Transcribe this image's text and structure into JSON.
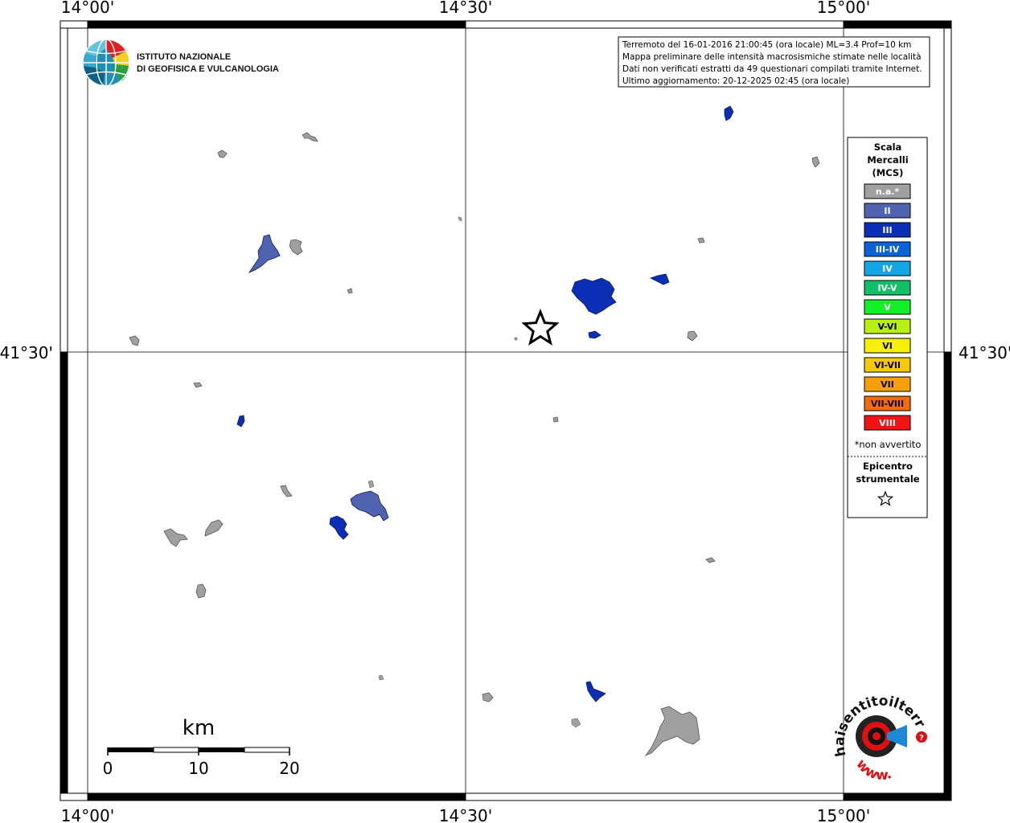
{
  "axes": {
    "top_labels": [
      "14°00'",
      "14°30'",
      "15°00'"
    ],
    "bottom_labels": [
      "14°00'",
      "14°30'",
      "15°00'"
    ],
    "left_label": "41°30'",
    "right_label": "41°30'"
  },
  "info_box": {
    "lines": [
      "Terremoto del 16-01-2016 21:00:45 (ora locale) ML=3.4 Prof=10 km",
      "Mappa preliminare delle intensità macrosismiche stimate nelle località",
      "Dati non verificati estratti da 49 questionari compilati tramite Internet.",
      "Ultimo aggiornamento: 20-12-2025 02:45 (ora locale)"
    ]
  },
  "logo": {
    "line1": "ISTITUTO NAZIONALE",
    "line2": "DI GEOFISICA E VULCANOLOGIA"
  },
  "legend": {
    "title": [
      "Scala",
      "Mercalli",
      "(MCS)"
    ],
    "items": [
      {
        "label": "n.a.*",
        "color": "#a0a0a0"
      },
      {
        "label": "II",
        "color": "#4f63b0"
      },
      {
        "label": "III",
        "color": "#0a2fb5"
      },
      {
        "label": "III-IV",
        "color": "#0a64d8"
      },
      {
        "label": "IV",
        "color": "#14a6e6"
      },
      {
        "label": "IV-V",
        "color": "#12c06a"
      },
      {
        "label": "V",
        "color": "#14f028"
      },
      {
        "label": "V-VI",
        "color": "#b8f014"
      },
      {
        "label": "VI",
        "color": "#f5f00a"
      },
      {
        "label": "VI-VII",
        "color": "#f5c80a"
      },
      {
        "label": "VII",
        "color": "#f5a00a"
      },
      {
        "label": "VII-VIII",
        "color": "#f56a0a"
      },
      {
        "label": "VIII",
        "color": "#f01414"
      }
    ],
    "note": "*non avvertito",
    "epicenter_title": [
      "Epicentro",
      "strumentale"
    ]
  },
  "scale_bar": {
    "title": "km",
    "labels": [
      "0",
      "10",
      "20"
    ]
  },
  "brand": {
    "name": "haisentitoilterremoto.it",
    "www": "www."
  },
  "colors": {
    "na": "#a0a0a0",
    "ii": "#4f63b0",
    "iii": "#0a2fb5",
    "frame": "#000000"
  },
  "localities": [
    {
      "intensity": "na"
    },
    {
      "intensity": "na"
    },
    {
      "intensity": "ii"
    },
    {
      "intensity": "na"
    },
    {
      "intensity": "na"
    },
    {
      "intensity": "na"
    },
    {
      "intensity": "na"
    },
    {
      "intensity": "iii"
    },
    {
      "intensity": "na"
    },
    {
      "intensity": "ii"
    },
    {
      "intensity": "iii"
    },
    {
      "intensity": "na"
    },
    {
      "intensity": "na"
    },
    {
      "intensity": "na"
    },
    {
      "intensity": "iii"
    },
    {
      "intensity": "iii"
    },
    {
      "intensity": "iii"
    },
    {
      "intensity": "iii"
    },
    {
      "intensity": "na"
    },
    {
      "intensity": "na"
    },
    {
      "intensity": "na"
    },
    {
      "intensity": "na"
    },
    {
      "intensity": "na"
    },
    {
      "intensity": "na"
    },
    {
      "intensity": "iii"
    },
    {
      "intensity": "na"
    }
  ]
}
